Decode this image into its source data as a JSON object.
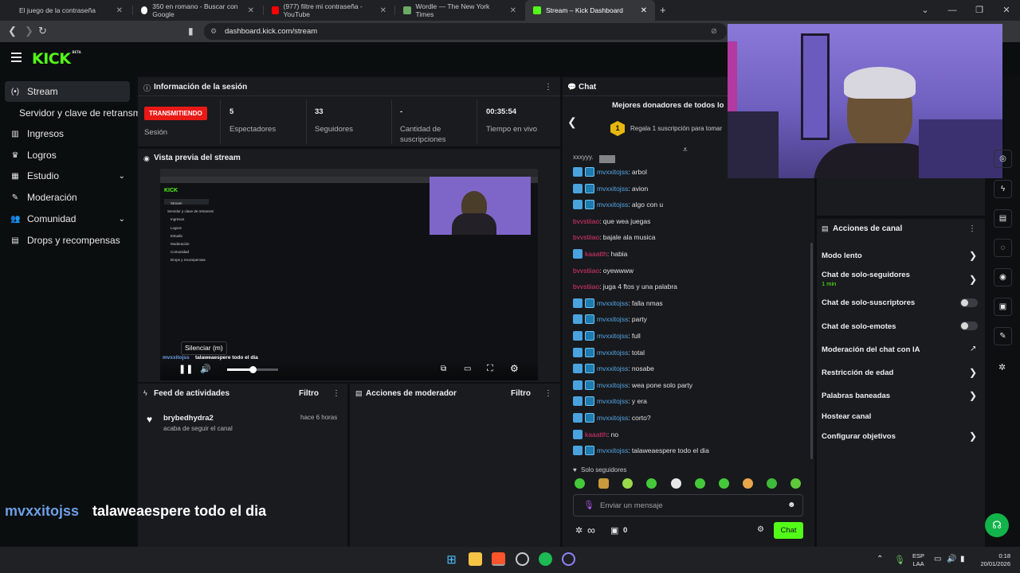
{
  "browser": {
    "tabs": [
      {
        "title": "El juego de la contraseña"
      },
      {
        "title": "350 en romano - Buscar con Google"
      },
      {
        "title": "(977) filtre mi contraseña - YouTube"
      },
      {
        "title": "Wordle — The New York Times"
      },
      {
        "title": "Stream – Kick Dashboard"
      }
    ],
    "new_tab": "+",
    "url": "dashboard.kick.com/stream"
  },
  "kick": {
    "logo": "KICK",
    "beta": "BETA"
  },
  "sidebar": {
    "items": [
      {
        "label": "Stream",
        "icon": "broadcast-icon"
      },
      {
        "label": "Servidor y clave de retransmi"
      },
      {
        "label": "Ingresos",
        "icon": "chart-icon"
      },
      {
        "label": "Logros",
        "icon": "trophy-icon"
      },
      {
        "label": "Estudio",
        "icon": "grid-icon"
      },
      {
        "label": "Moderación",
        "icon": "wrench-icon"
      },
      {
        "label": "Comunidad",
        "icon": "users-icon"
      },
      {
        "label": "Drops y recompensas",
        "icon": "drops-icon"
      }
    ]
  },
  "session": {
    "title": "Información de la sesión",
    "badge": "TRANSMITIENDO",
    "badge_label": "Sesión",
    "stats": [
      {
        "value": "5",
        "label": "Espectadores"
      },
      {
        "value": "33",
        "label": "Seguidores"
      },
      {
        "value": "-",
        "label": "Cantidad de suscripciones"
      },
      {
        "value": "00:35:54",
        "label": "Tiempo en vivo"
      }
    ]
  },
  "preview": {
    "title": "Vista previa del stream",
    "tooltip": "Silenciar (m)",
    "overlay_user": "mvxxitojss",
    "overlay_msg": "talaweaespere todo el dia",
    "mini_sidebar": [
      "Stream",
      "Servidor y clave de retransmi",
      "Ingresos",
      "Logros",
      "Estudio",
      "Moderación",
      "Comunidad",
      "Drops y recompensas"
    ],
    "volume": 0.5
  },
  "activity": {
    "title": "Feed de actividades",
    "filter": "Filtro",
    "items": [
      {
        "user": "brybedhydra2",
        "time": "hace 6 horas",
        "action": "acaba de seguir el canal"
      }
    ]
  },
  "modactions": {
    "title": "Acciones de moderador",
    "filter": "Filtro"
  },
  "chat": {
    "title": "Chat",
    "donors_title": "Mejores donadores de todos lo",
    "donor_rank": "1",
    "donor_text": "Regala 1 suscripción para tomar",
    "top_partial": "xxxyyy.",
    "messages": [
      {
        "user": "mvxxitojss",
        "text": ": arbol",
        "kind": "sub"
      },
      {
        "user": "mvxxitojss",
        "text": ": avion",
        "kind": "sub"
      },
      {
        "user": "mvxxitojss",
        "text": ": algo con u",
        "kind": "sub"
      },
      {
        "user": "bvvstiiao",
        "text": ": que wea juegas",
        "kind": "plain"
      },
      {
        "user": "bvvstiiao",
        "text": ": bajale ala musica",
        "kind": "plain"
      },
      {
        "user": "kaaatth",
        "text": ": habia",
        "kind": "mod"
      },
      {
        "user": "bvvstiiao",
        "text": ": oyewwww",
        "kind": "plain"
      },
      {
        "user": "bvvstiiao",
        "text": ": juga 4 ftos y una palabra",
        "kind": "plain"
      },
      {
        "user": "mvxxitojss",
        "text": ": falla nmas",
        "kind": "sub"
      },
      {
        "user": "mvxxitojss",
        "text": ": party",
        "kind": "sub"
      },
      {
        "user": "mvxxitojss",
        "text": ": full",
        "kind": "sub"
      },
      {
        "user": "mvxxitojss",
        "text": ": total",
        "kind": "sub"
      },
      {
        "user": "mvxxitojss",
        "text": ": nosabe",
        "kind": "sub"
      },
      {
        "user": "mvxxitojss",
        "text": ": wea pone solo party",
        "kind": "sub"
      },
      {
        "user": "mvxxitojss",
        "text": ": y era",
        "kind": "sub"
      },
      {
        "user": "mvxxitojss",
        "text": ": corto?",
        "kind": "sub"
      },
      {
        "user": "kaaatth",
        "text": ": no",
        "kind": "mod"
      },
      {
        "user": "mvxxitojss",
        "text": ": talaweaespere todo el dia",
        "kind": "sub"
      }
    ],
    "followers_only": "Solo seguidores",
    "input_placeholder": "Enviar un mensaje",
    "points": "0",
    "send": "Chat"
  },
  "channel_actions": {
    "title": "Acciones de canal",
    "rows": [
      {
        "label": "Modo lento",
        "control": "arrow"
      },
      {
        "label": "Chat de solo-seguidores",
        "sub": "1 min",
        "control": "arrow"
      },
      {
        "label": "Chat de solo-suscriptores",
        "control": "toggle"
      },
      {
        "label": "Chat de solo-emotes",
        "control": "toggle"
      },
      {
        "label": "Moderación del chat con IA",
        "control": "external"
      },
      {
        "label": "Restricción de edad",
        "control": "arrow"
      },
      {
        "label": "Palabras baneadas",
        "control": "arrow"
      },
      {
        "label": "Hostear canal",
        "control": "none"
      },
      {
        "label": "Configurar objetivos",
        "control": "arrow"
      }
    ]
  },
  "overlay_caption": {
    "user": "mvxxitojss",
    "text": "talaweaespere todo el dia"
  },
  "taskbar": {
    "lang": "ESP",
    "layout": "LAA",
    "time": "0:18",
    "date": "20/01/2026"
  },
  "colors": {
    "kick_green": "#53fc18",
    "live_red": "#e91916",
    "sub_blue": "#58a6e6",
    "user_red": "#e2356d"
  }
}
